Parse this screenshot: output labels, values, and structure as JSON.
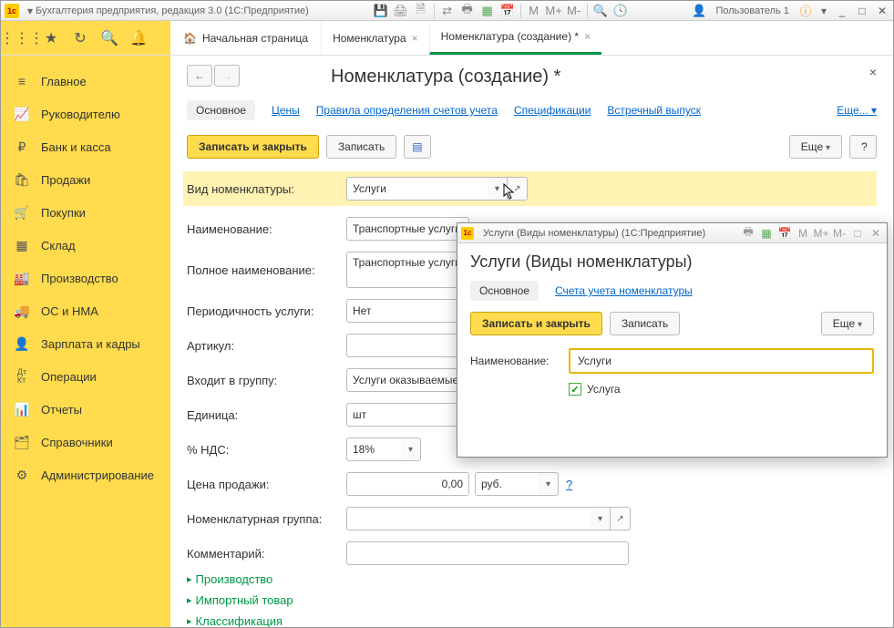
{
  "titlebar": {
    "title": "Бухгалтерия предприятия, редакция 3.0  (1С:Предприятие)",
    "user_label": "Пользователь 1",
    "m": "M",
    "mp": "M+",
    "mm": "M-"
  },
  "tabs": {
    "home": "Начальная страница",
    "t1": "Номенклатура",
    "t2": "Номенклатура (создание) *"
  },
  "sidebar": {
    "items": [
      "Главное",
      "Руководителю",
      "Банк и касса",
      "Продажи",
      "Покупки",
      "Склад",
      "Производство",
      "ОС и НМА",
      "Зарплата и кадры",
      "Операции",
      "Отчеты",
      "Справочники",
      "Администрирование"
    ]
  },
  "page": {
    "title": "Номенклатура (создание) *",
    "hnav": {
      "osnov": "Основное",
      "ceny": "Цены",
      "pravila": "Правила определения счетов учета",
      "spec": "Спецификации",
      "vstr": "Встречный выпуск",
      "more": "Еще..."
    },
    "actions": {
      "save_close": "Записать и закрыть",
      "save": "Записать",
      "more": "Еще",
      "help": "?"
    },
    "form": {
      "vid_label": "Вид номенклатуры:",
      "vid_value": "Услуги",
      "name_label": "Наименование:",
      "name_value": "Транспортные услуги",
      "full_label": "Полное наименование:",
      "full_value": "Транспортные услуги",
      "period_label": "Периодичность услуги:",
      "period_value": "Нет",
      "artikul_label": "Артикул:",
      "group_label": "Входит в группу:",
      "group_value": "Услуги оказываемые",
      "ed_label": "Единица:",
      "ed_value": "шт",
      "nds_label": "% НДС:",
      "nds_value": "18%",
      "price_label": "Цена продажи:",
      "price_value": "0,00",
      "price_cur": "руб.",
      "price_help": "?",
      "nomgrp_label": "Номенклатурная группа:",
      "comment_label": "Комментарий:",
      "exp1": "Производство",
      "exp2": "Импортный товар",
      "exp3": "Классификация"
    }
  },
  "dialog": {
    "title": "Услуги (Виды номенклатуры)  (1С:Предприятие)",
    "heading": "Услуги (Виды номенклатуры)",
    "hnav": {
      "osnov": "Основное",
      "scheta": "Счета учета номенклатуры"
    },
    "actions": {
      "save_close": "Записать и закрыть",
      "save": "Записать",
      "more": "Еще"
    },
    "name_label": "Наименование:",
    "name_value": "Услуги",
    "chk_label": "Услуга",
    "m": "M",
    "mp": "M+",
    "mm": "M-"
  }
}
